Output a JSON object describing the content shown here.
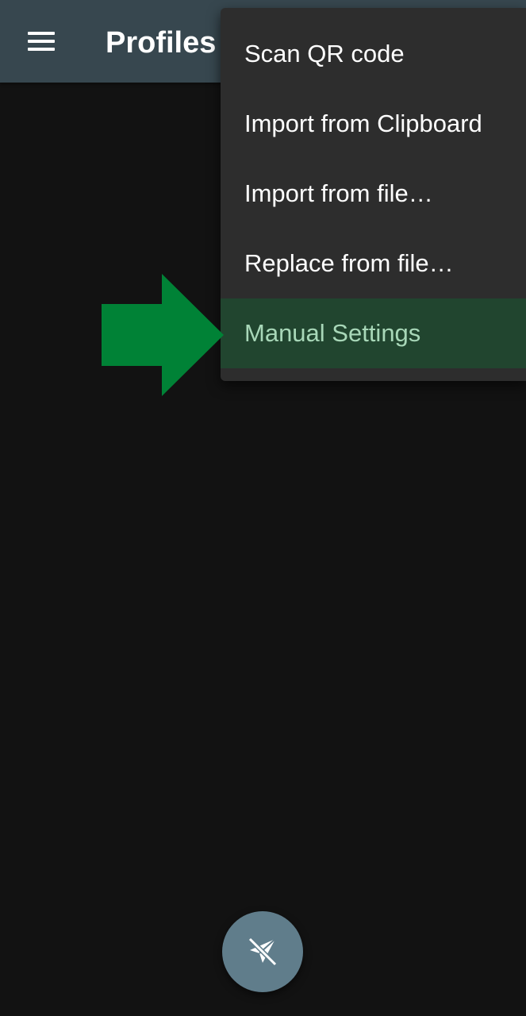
{
  "appbar": {
    "title": "Profiles",
    "color": "#37474f",
    "menu_icon": "hamburger-menu-icon"
  },
  "overflow_menu": {
    "items": [
      {
        "label": "Scan QR code",
        "highlighted": false
      },
      {
        "label": "Import from Clipboard",
        "highlighted": false
      },
      {
        "label": "Import from file…",
        "highlighted": false
      },
      {
        "label": "Replace from file…",
        "highlighted": false
      },
      {
        "label": "Manual Settings",
        "highlighted": true
      }
    ],
    "highlight_color": "#21452f"
  },
  "annotation": {
    "icon": "green-arrow-right-icon",
    "color": "#008236"
  },
  "fab": {
    "icon": "paper-plane-disconnected-icon",
    "color": "#607d8b"
  }
}
